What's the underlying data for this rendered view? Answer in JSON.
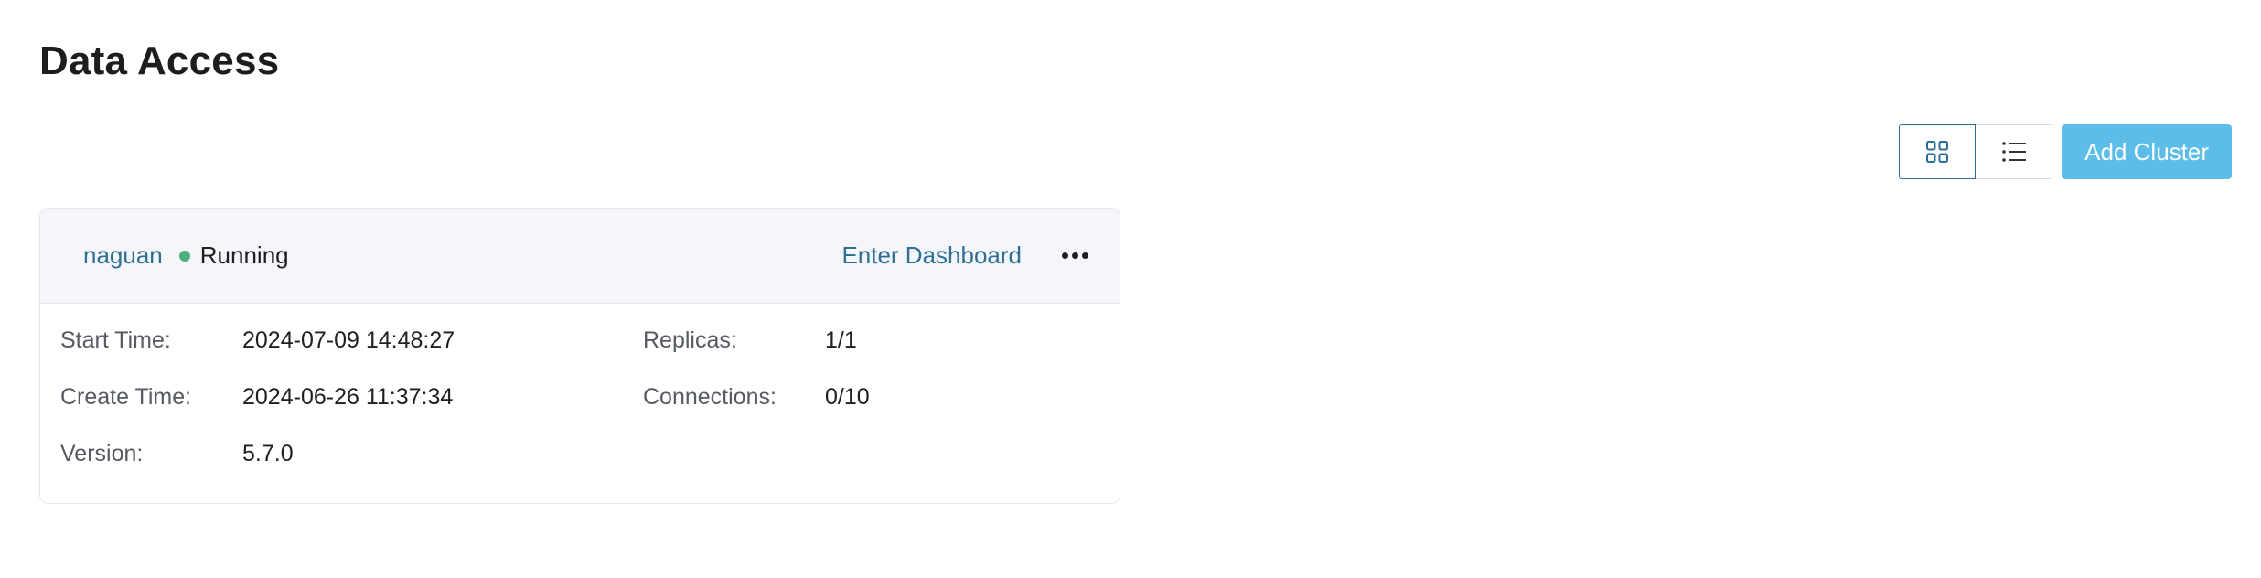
{
  "page": {
    "title": "Data Access"
  },
  "toolbar": {
    "grid_view_icon": "grid-icon",
    "list_view_icon": "list-icon",
    "add_label": "Add Cluster",
    "accent_color": "#5bbde8"
  },
  "cluster": {
    "name": "naguan",
    "status": "Running",
    "status_color": "#4caf7f",
    "enter_label": "Enter Dashboard",
    "more_icon": "more-horizontal-icon",
    "fields": {
      "start_time_label": "Start Time",
      "start_time_value": "2024-07-09 14:48:27",
      "create_time_label": "Create Time",
      "create_time_value": "2024-06-26 11:37:34",
      "version_label": "Version",
      "version_value": "5.7.0",
      "replicas_label": "Replicas",
      "replicas_value": "1/1",
      "connections_label": "Connections",
      "connections_value": "0/10"
    },
    "separator": ":"
  }
}
